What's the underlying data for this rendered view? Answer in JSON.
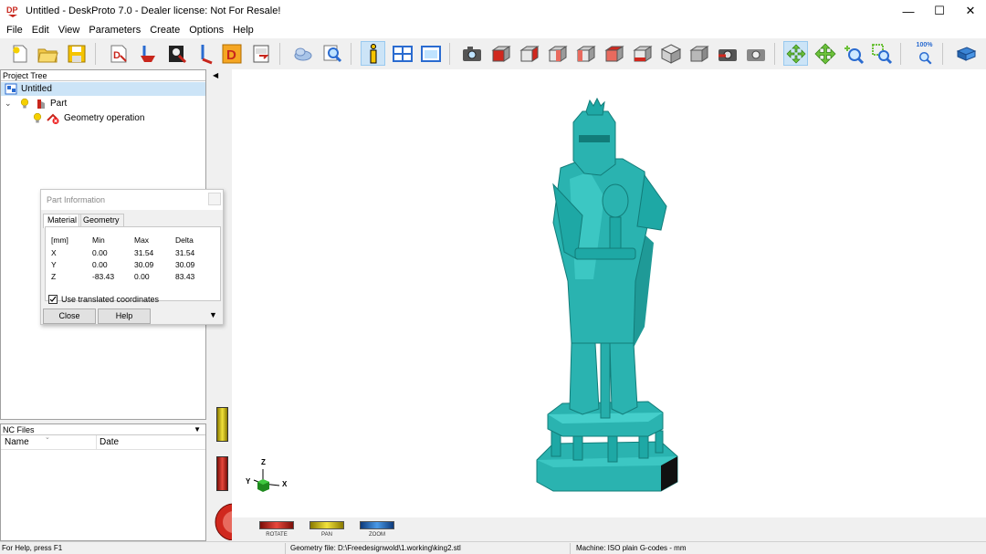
{
  "window": {
    "title": "Untitled - DeskProto 7.0 - Dealer license: Not For Resale!",
    "logo_text": "DP",
    "controls": [
      "—",
      "☐",
      "✕"
    ]
  },
  "menu": [
    "File",
    "Edit",
    "View",
    "Parameters",
    "Create",
    "Options",
    "Help"
  ],
  "toolbar": {
    "zoom_label": "100%",
    "icons": [
      "new-file-icon",
      "open-folder-icon",
      "save-icon",
      "import-icon",
      "run-icon",
      "portrait-icon",
      "tool-icon",
      "d-icon",
      "export-icon",
      "cloud-icon",
      "search-icon",
      "info-icon",
      "layout-icon",
      "window-icon",
      "camera-icon",
      "view-front-icon",
      "view-left-icon",
      "view-right-icon",
      "view-back-icon",
      "view-top-icon",
      "view-bottom-icon",
      "view-iso-1-icon",
      "view-iso-2-icon",
      "view-refresh-icon",
      "view-reset-icon",
      "rotate-arrows-icon",
      "pan-arrows-icon",
      "zoom-in-icon",
      "zoom-window-icon",
      "zoom-100-icon",
      "book-icon"
    ]
  },
  "project_tree": {
    "header": "Project Tree",
    "items": [
      {
        "label": "Untitled",
        "level": 0
      },
      {
        "label": "Part",
        "level": 1
      },
      {
        "label": "Geometry operation",
        "level": 2
      }
    ]
  },
  "nc_files": {
    "header": "NC Files",
    "columns": [
      "Name",
      "Date"
    ]
  },
  "part_info": {
    "title": "Part Information",
    "tabs": [
      "Material",
      "Geometry"
    ],
    "active_tab": "Material",
    "headers": [
      "[mm]",
      "Min",
      "Max",
      "Delta"
    ],
    "rows": [
      [
        "X",
        "0.00",
        "31.54",
        "31.54"
      ],
      [
        "Y",
        "0.00",
        "30.09",
        "30.09"
      ],
      [
        "Z",
        "-83.43",
        "0.00",
        "83.43"
      ]
    ],
    "checkbox_label": "Use translated coordinates",
    "checkbox_checked": true,
    "close_label": "Close",
    "help_label": "Help"
  },
  "axes": {
    "x": "X",
    "y": "Y",
    "z": "Z"
  },
  "view_controls": {
    "rotate": "ROTATE",
    "pan": "PAN",
    "zoom": "ZOOM"
  },
  "statusbar": {
    "help": "For Help, press F1",
    "geometry_file": "Geometry file: D:\\Freedesignwold\\1.working\\king2.stl",
    "machine": "Machine: ISO plain G-codes - mm"
  },
  "colors": {
    "model": "#2ab3b0",
    "model_dark": "#16807e",
    "selection": "#cce4f7",
    "rotate_red": "#d0281e",
    "pan_yellow": "#e8d21a",
    "zoom_blue": "#2a7fd4"
  }
}
